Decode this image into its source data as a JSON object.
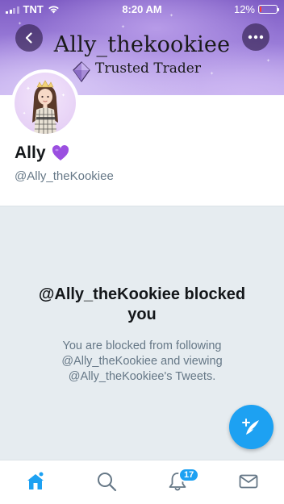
{
  "status_bar": {
    "carrier": "TNT",
    "time": "8:20 AM",
    "battery_percent": "12%",
    "battery_level": 0.12,
    "battery_color": "#ff3b30"
  },
  "header": {
    "banner_title": "Ally_thekookiee",
    "banner_subtitle": "Trusted Trader",
    "back_icon": "chevron-left-icon",
    "more_icon": "more-horizontal-icon"
  },
  "profile": {
    "display_name": "Ally",
    "name_emoji": "💜",
    "handle": "@Ally_theKookiee"
  },
  "blocked": {
    "title": "@Ally_theKookiee blocked you",
    "description": "You are blocked from following @Ally_theKookiee and viewing @Ally_theKookiee's Tweets."
  },
  "fab": {
    "icon": "compose-tweet-icon"
  },
  "tab_bar": {
    "tabs": [
      {
        "name": "home",
        "icon": "home-icon",
        "active": true
      },
      {
        "name": "search",
        "icon": "search-icon",
        "active": false
      },
      {
        "name": "notifications",
        "icon": "bell-icon",
        "active": false,
        "badge": "17"
      },
      {
        "name": "messages",
        "icon": "mail-icon",
        "active": false
      }
    ]
  },
  "colors": {
    "accent": "#1da1f2",
    "panel_background": "#e6ecf0",
    "secondary_text": "#657786"
  }
}
